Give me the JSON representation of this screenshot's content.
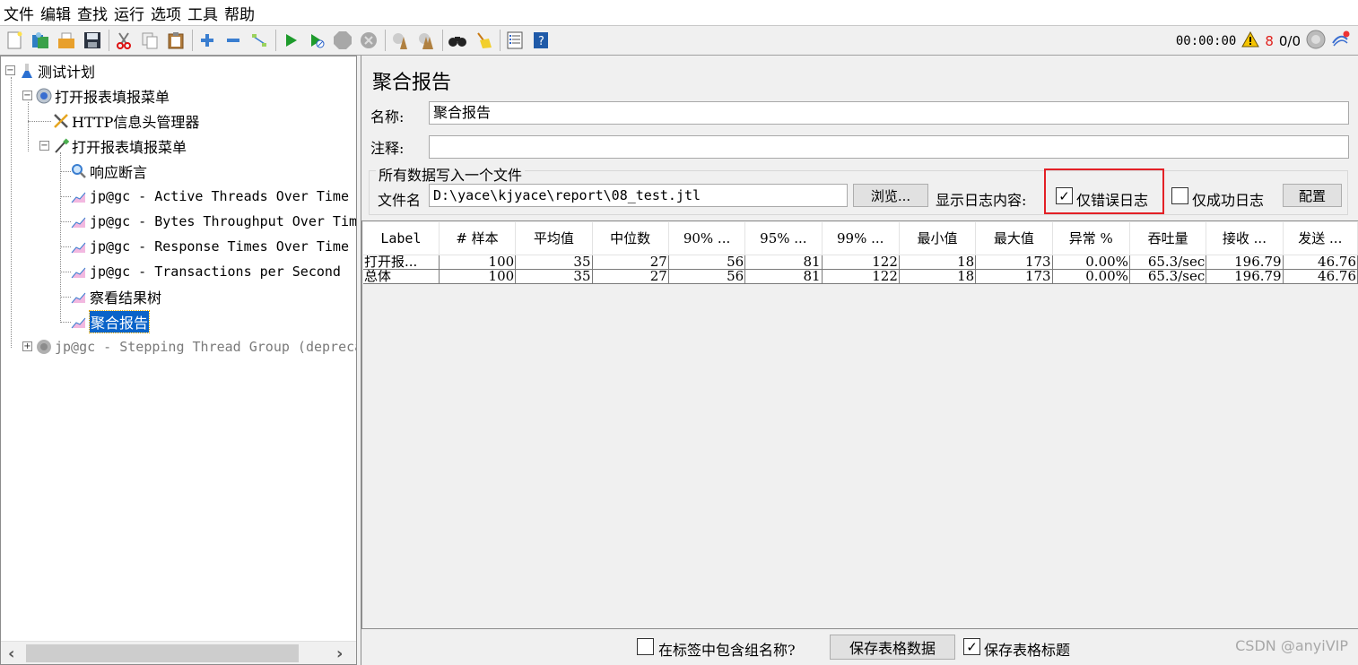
{
  "menubar": [
    "文件",
    "编辑",
    "查找",
    "运行",
    "选项",
    "工具",
    "帮助"
  ],
  "toolbar": {
    "icons": [
      "new-icon",
      "templates-icon",
      "open-icon",
      "save-icon",
      "cut-icon",
      "copy-icon",
      "paste-icon",
      "expand-icon",
      "collapse-icon",
      "toggle-icon",
      "start-icon",
      "start-no-pause-icon",
      "stop-icon",
      "shutdown-icon",
      "clear-icon",
      "clear-all-icon",
      "search-icon",
      "reset-search-icon",
      "function-helper-icon",
      "help-icon"
    ],
    "timer": "00:00:00",
    "warning_count": "8",
    "threads": "0/0"
  },
  "tree": {
    "nodes": [
      {
        "label": "测试计划",
        "icon": "test-plan-icon",
        "level": 0
      },
      {
        "label": "打开报表填报菜单",
        "icon": "thread-group-icon",
        "level": 1
      },
      {
        "label": "HTTP信息头管理器",
        "icon": "header-manager-icon",
        "level": 2
      },
      {
        "label": "打开报表填报菜单",
        "icon": "sampler-icon",
        "level": 2
      },
      {
        "label": "响应断言",
        "icon": "assertion-icon",
        "level": 3
      },
      {
        "label": "jp@gc - Active Threads Over Time",
        "icon": "listener-icon",
        "level": 3
      },
      {
        "label": "jp@gc - Bytes Throughput Over Time",
        "icon": "listener-icon",
        "level": 3
      },
      {
        "label": "jp@gc - Response Times Over Time",
        "icon": "listener-icon",
        "level": 3
      },
      {
        "label": "jp@gc - Transactions per Second",
        "icon": "listener-icon",
        "level": 3
      },
      {
        "label": "察看结果树",
        "icon": "listener-icon",
        "level": 3
      },
      {
        "label": "聚合报告",
        "icon": "listener-icon",
        "level": 3,
        "selected": true
      },
      {
        "label": "jp@gc - Stepping Thread Group (deprecated)",
        "icon": "thread-group-disabled-icon",
        "level": 1
      }
    ]
  },
  "panel": {
    "title": "聚合报告",
    "name_label": "名称:",
    "name_value": "聚合报告",
    "comment_label": "注释:",
    "comment_value": "",
    "file_group_title": "所有数据写入一个文件",
    "filename_label": "文件名",
    "filename_value": "D:\\yace\\kjyace\\report\\08_test.jtl",
    "browse_label": "浏览...",
    "log_content_label": "显示日志内容:",
    "errors_only_label": "仅错误日志",
    "errors_only_checked": true,
    "success_only_label": "仅成功日志",
    "success_only_checked": false,
    "config_label": "配置"
  },
  "table": {
    "columns": [
      "Label",
      "# 样本",
      "平均值",
      "中位数",
      "90% ...",
      "95% ...",
      "99% ...",
      "最小值",
      "最大值",
      "异常 %",
      "吞吐量",
      "接收 ...",
      "发送 ..."
    ],
    "rows": [
      [
        "打开报...",
        "100",
        "35",
        "27",
        "56",
        "81",
        "122",
        "18",
        "173",
        "0.00%",
        "65.3/sec",
        "196.79",
        "46.76"
      ],
      [
        "总体",
        "100",
        "35",
        "27",
        "56",
        "81",
        "122",
        "18",
        "173",
        "0.00%",
        "65.3/sec",
        "196.79",
        "46.76"
      ]
    ]
  },
  "bottom": {
    "include_group_label": "在标签中包含组名称?",
    "include_group_checked": false,
    "save_table_label": "保存表格数据",
    "save_header_label": "保存表格标题",
    "save_header_checked": true,
    "watermark": "CSDN @anyiVIP"
  },
  "colors": {
    "selection": "#0a63c9",
    "highlight": "#e32026",
    "warning": "#e0201c"
  }
}
